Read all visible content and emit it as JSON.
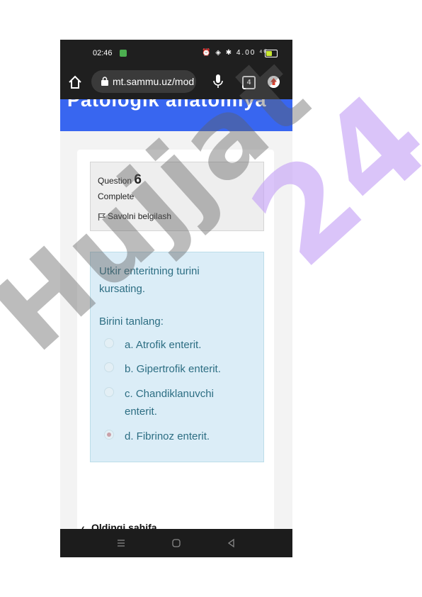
{
  "status_bar": {
    "time": "02:46",
    "icons_text": "⏰ ◈ ✱ 4.00 ⁴ᴳ",
    "colors": {
      "app_dot": "#4caf50",
      "battery": "#c8e832"
    },
    "battery_fraction": 0.55
  },
  "browser": {
    "url": "mt.sammu.uz/mod/",
    "tabs_count": "4",
    "icons": [
      "home-icon",
      "lock-icon",
      "mic-icon",
      "menu-up-icon"
    ]
  },
  "site": {
    "title": "Patologik anatomiya",
    "accent": "#3866f0"
  },
  "question": {
    "label": "Question",
    "number": "6",
    "state": "Complete",
    "flag_label": "Savolni belgilash",
    "text": "Utkir enteritning turini kursating.",
    "prompt": "Birini tanlang:",
    "options": [
      {
        "label": "a. Atrofik enterit.",
        "selected": false
      },
      {
        "label": "b. Gipertrofik enterit.",
        "selected": false
      },
      {
        "label": "c. Chandiklanuvchi enterit.",
        "selected": false
      },
      {
        "label": "d. Fibrinoz enterit.",
        "selected": true
      }
    ]
  },
  "navigation": {
    "previous": "Oldingi sahifa"
  },
  "watermark": {
    "word": "Hujjat",
    "number": "24"
  }
}
